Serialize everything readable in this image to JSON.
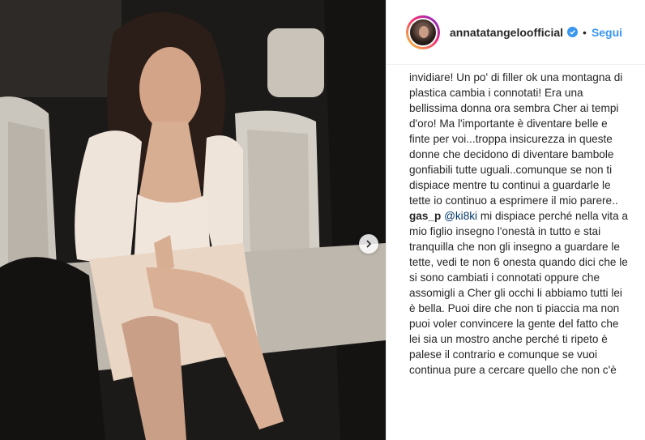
{
  "post": {
    "image_alt": "Woman in a cream blazer and lace skirt sitting in a car",
    "next_icon": "chevron-right-icon"
  },
  "header": {
    "username": "annatatangeloofficial",
    "verified_icon": "verified-badge-icon",
    "separator": "•",
    "follow_label": "Segui"
  },
  "comments": {
    "first_text": "invidiare! Un po' di filler ok una montagna di plastica cambia i connotati! Era una bellissima donna ora sembra Cher ai tempi d'oro! Ma l'importante è diventare belle e finte per voi...troppa insicurezza in queste donne che decidono di diventare bambole gonfiabili tutte uguali..comunque se non ti dispiace mentre tu continui a guardarle le tette io continuo a esprimere il mio parere..",
    "second_user": "gas_p",
    "second_mention": "@ki8ki",
    "second_text": "mi dispiace perché nella vita a mio figlio insegno l'onestà in tutto e stai tranquilla che non gli insegno a guardare le tette, vedi te non 6 onesta quando dici che le si sono cambiati i connotati oppure che assomigli a Cher gli occhi li abbiamo tutti lei è bella. Puoi dire che non ti piaccia ma non puoi voler convincere la gente del fatto che lei sia un mostro anche perché ti ripeto è palese il contrario e comunque se vuoi continua pure a cercare quello che non c'è"
  },
  "colors": {
    "link": "#3897f0",
    "mention": "#003569",
    "text": "#262626"
  }
}
